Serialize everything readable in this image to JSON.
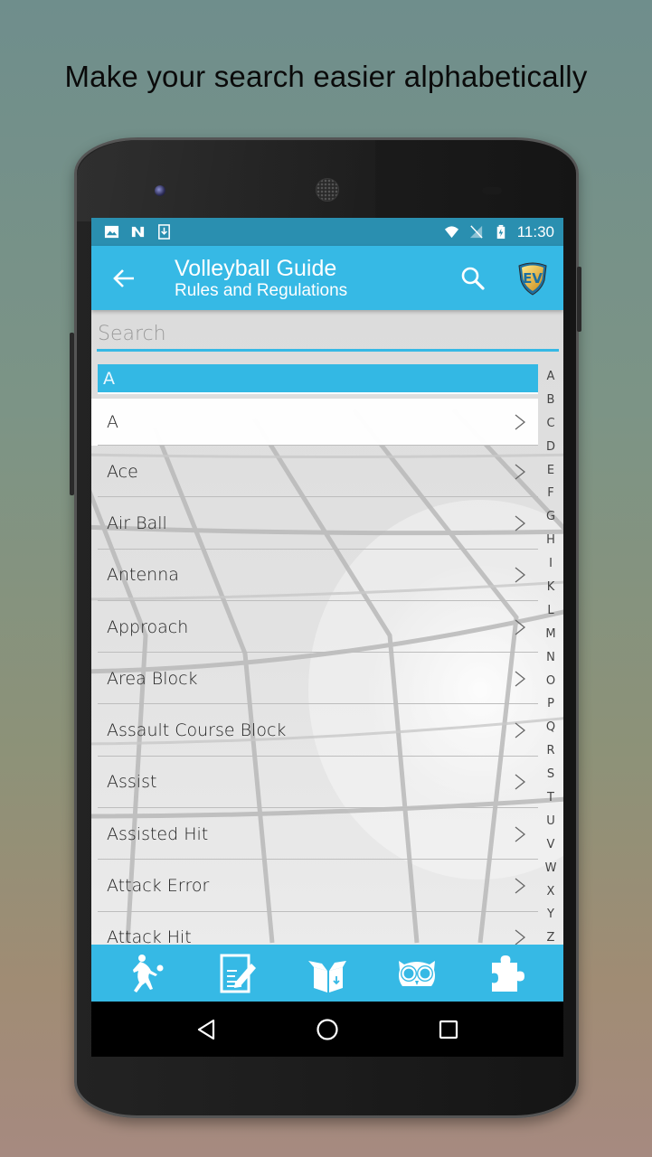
{
  "promo": {
    "headline": "Make your search easier alphabetically"
  },
  "status_bar": {
    "time": "11:30",
    "left_icons": [
      "image-icon",
      "n-notification-icon",
      "download-icon"
    ],
    "right_icons": [
      "wifi-icon",
      "no-signal-icon",
      "battery-charging-icon"
    ]
  },
  "app_bar": {
    "title": "Volleyball Guide",
    "subtitle": "Rules and Regulations",
    "back_icon": "arrow-left-icon",
    "search_icon": "search-icon",
    "logo_text": "EV"
  },
  "search": {
    "placeholder": "Search",
    "value": ""
  },
  "section_header": "A",
  "list": {
    "items": [
      {
        "label": "A"
      },
      {
        "label": "Ace"
      },
      {
        "label": "Air Ball"
      },
      {
        "label": "Antenna"
      },
      {
        "label": "Approach"
      },
      {
        "label": "Area Block"
      },
      {
        "label": "Assault Course Block"
      },
      {
        "label": "Assist"
      },
      {
        "label": "Assisted Hit"
      },
      {
        "label": "Attack Error"
      },
      {
        "label": "Attack Hit"
      }
    ]
  },
  "alphabet_index": [
    "A",
    "B",
    "C",
    "D",
    "E",
    "F",
    "G",
    "H",
    "I",
    "K",
    "L",
    "M",
    "N",
    "O",
    "P",
    "Q",
    "R",
    "S",
    "T",
    "U",
    "V",
    "W",
    "X",
    "Y",
    "Z"
  ],
  "bottom_bar": {
    "items": [
      {
        "icon": "volleyball-player-icon"
      },
      {
        "icon": "edit-document-icon"
      },
      {
        "icon": "box-download-icon"
      },
      {
        "icon": "owl-icon"
      },
      {
        "icon": "puzzle-icon"
      }
    ]
  },
  "nav_bar": {
    "items": [
      "back-triangle-icon",
      "home-circle-icon",
      "recents-square-icon"
    ]
  },
  "colors": {
    "accent": "#36b9e5",
    "status_bar": "#2a8fb0",
    "section_header": "#33b8e4"
  }
}
